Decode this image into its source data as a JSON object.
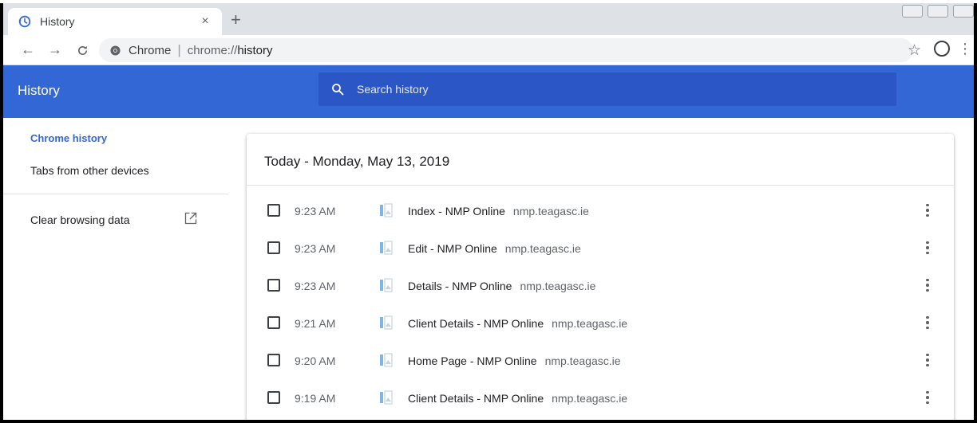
{
  "tab": {
    "title": "History",
    "close_glyph": "×",
    "new_tab_glyph": "+"
  },
  "omnibox": {
    "chip_label": "Chrome",
    "url_scheme": "chrome://",
    "url_path": "history"
  },
  "header": {
    "title": "History",
    "search_placeholder": "Search history",
    "accent_color": "#3367d6"
  },
  "sidebar": {
    "items": [
      {
        "label": "Chrome history",
        "active": true
      },
      {
        "label": "Tabs from other devices",
        "active": false
      },
      {
        "label": "Clear browsing data",
        "active": false
      }
    ]
  },
  "history": {
    "date_heading": "Today - Monday, May 13, 2019",
    "entries": [
      {
        "time": "9:23 AM",
        "title": "Index - NMP Online",
        "domain": "nmp.teagasc.ie"
      },
      {
        "time": "9:23 AM",
        "title": "Edit - NMP Online",
        "domain": "nmp.teagasc.ie"
      },
      {
        "time": "9:23 AM",
        "title": "Details - NMP Online",
        "domain": "nmp.teagasc.ie"
      },
      {
        "time": "9:21 AM",
        "title": "Client Details - NMP Online",
        "domain": "nmp.teagasc.ie"
      },
      {
        "time": "9:20 AM",
        "title": "Home Page - NMP Online",
        "domain": "nmp.teagasc.ie"
      },
      {
        "time": "9:19 AM",
        "title": "Client Details - NMP Online",
        "domain": "nmp.teagasc.ie"
      }
    ]
  }
}
